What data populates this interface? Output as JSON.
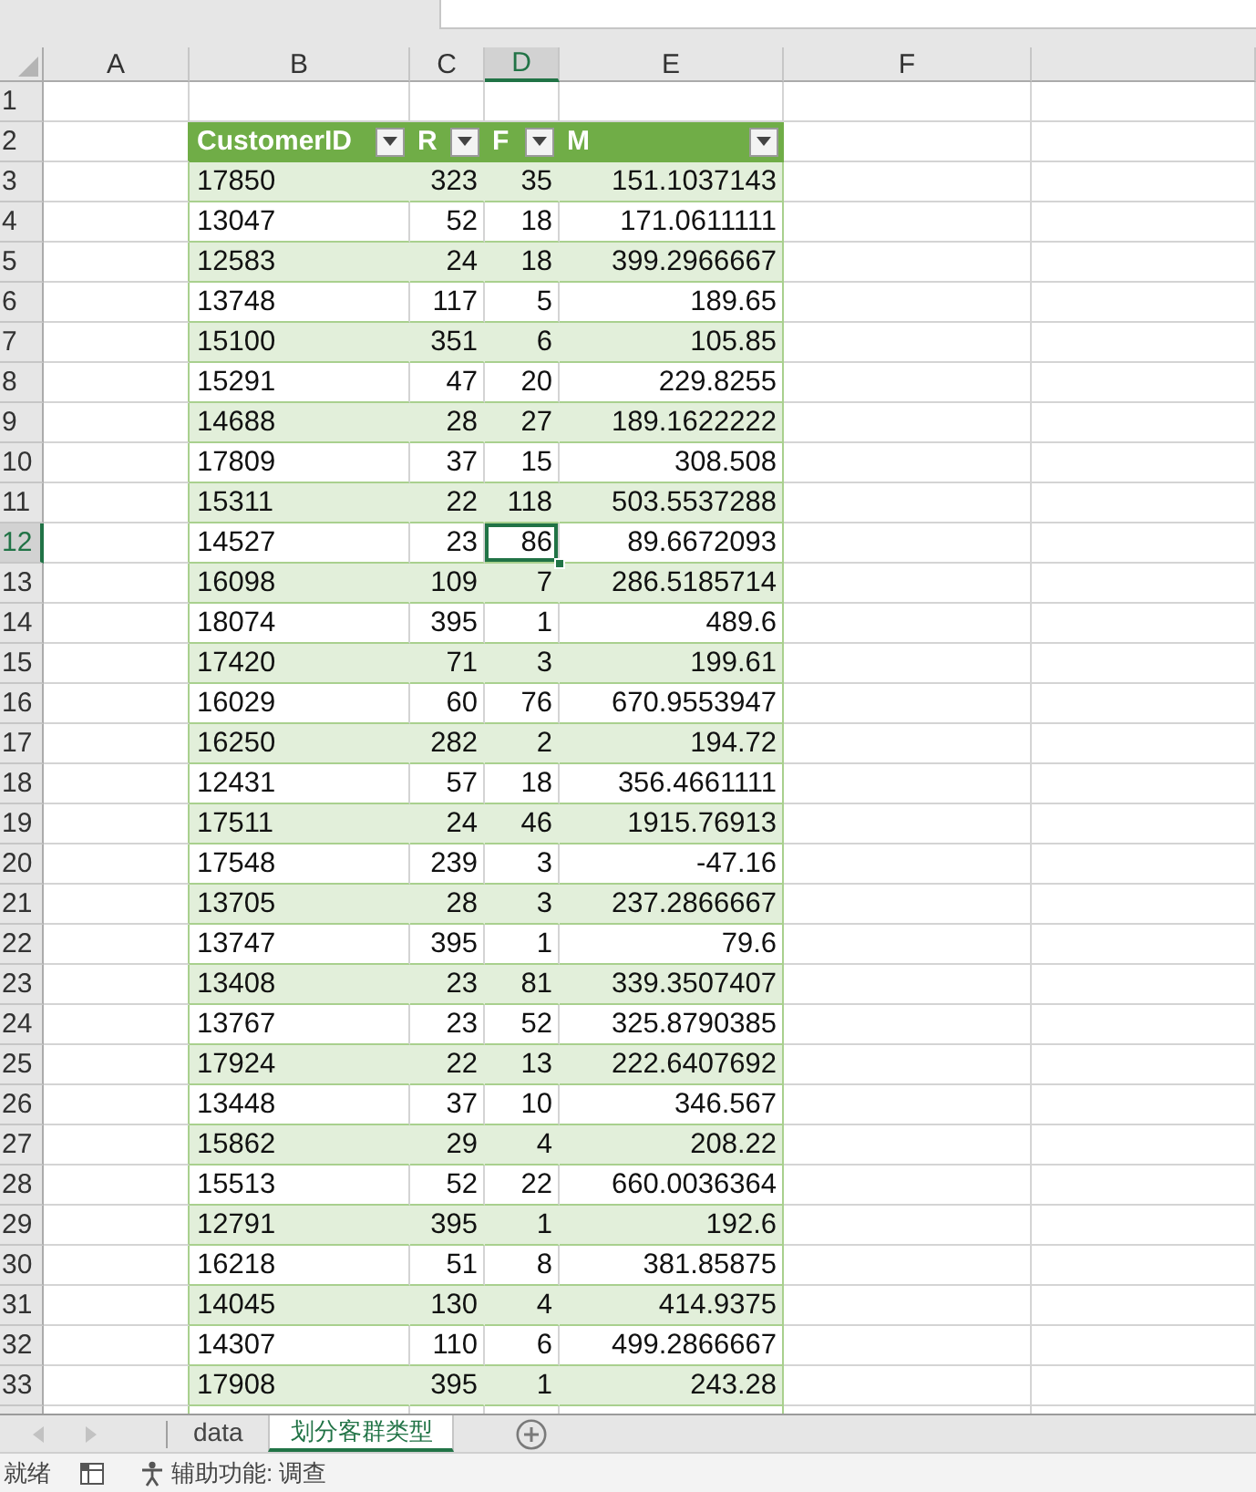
{
  "column_headers": [
    {
      "label": "A",
      "selected": false
    },
    {
      "label": "B",
      "selected": false
    },
    {
      "label": "C",
      "selected": false
    },
    {
      "label": "D",
      "selected": true
    },
    {
      "label": "E",
      "selected": false
    },
    {
      "label": "F",
      "selected": false
    }
  ],
  "row_headers": [
    {
      "label": "1",
      "selected": false
    },
    {
      "label": "2",
      "selected": false
    },
    {
      "label": "3",
      "selected": false
    },
    {
      "label": "4",
      "selected": false
    },
    {
      "label": "5",
      "selected": false
    },
    {
      "label": "6",
      "selected": false
    },
    {
      "label": "7",
      "selected": false
    },
    {
      "label": "8",
      "selected": false
    },
    {
      "label": "9",
      "selected": false
    },
    {
      "label": "10",
      "selected": false
    },
    {
      "label": "11",
      "selected": false
    },
    {
      "label": "12",
      "selected": true
    },
    {
      "label": "13",
      "selected": false
    },
    {
      "label": "14",
      "selected": false
    },
    {
      "label": "15",
      "selected": false
    },
    {
      "label": "16",
      "selected": false
    },
    {
      "label": "17",
      "selected": false
    },
    {
      "label": "18",
      "selected": false
    },
    {
      "label": "19",
      "selected": false
    },
    {
      "label": "20",
      "selected": false
    },
    {
      "label": "21",
      "selected": false
    },
    {
      "label": "22",
      "selected": false
    },
    {
      "label": "23",
      "selected": false
    },
    {
      "label": "24",
      "selected": false
    },
    {
      "label": "25",
      "selected": false
    },
    {
      "label": "26",
      "selected": false
    },
    {
      "label": "27",
      "selected": false
    },
    {
      "label": "28",
      "selected": false
    },
    {
      "label": "29",
      "selected": false
    },
    {
      "label": "30",
      "selected": false
    },
    {
      "label": "31",
      "selected": false
    },
    {
      "label": "32",
      "selected": false
    },
    {
      "label": "33",
      "selected": false
    }
  ],
  "table": {
    "columns": [
      {
        "label": "CustomerID",
        "kind": "text",
        "filter": true
      },
      {
        "label": "R",
        "kind": "number",
        "filter": true
      },
      {
        "label": "F",
        "kind": "number",
        "filter": true
      },
      {
        "label": "M",
        "kind": "number",
        "filter": true
      }
    ],
    "rows": [
      [
        {
          "text": "17850",
          "selected": false
        },
        {
          "text": "323",
          "selected": false
        },
        {
          "text": "35",
          "selected": false
        },
        {
          "text": "151.1037143",
          "selected": false
        }
      ],
      [
        {
          "text": "13047",
          "selected": false
        },
        {
          "text": "52",
          "selected": false
        },
        {
          "text": "18",
          "selected": false
        },
        {
          "text": "171.0611111",
          "selected": false
        }
      ],
      [
        {
          "text": "12583",
          "selected": false
        },
        {
          "text": "24",
          "selected": false
        },
        {
          "text": "18",
          "selected": false
        },
        {
          "text": "399.2966667",
          "selected": false
        }
      ],
      [
        {
          "text": "13748",
          "selected": false
        },
        {
          "text": "117",
          "selected": false
        },
        {
          "text": "5",
          "selected": false
        },
        {
          "text": "189.65",
          "selected": false
        }
      ],
      [
        {
          "text": "15100",
          "selected": false
        },
        {
          "text": "351",
          "selected": false
        },
        {
          "text": "6",
          "selected": false
        },
        {
          "text": "105.85",
          "selected": false
        }
      ],
      [
        {
          "text": "15291",
          "selected": false
        },
        {
          "text": "47",
          "selected": false
        },
        {
          "text": "20",
          "selected": false
        },
        {
          "text": "229.8255",
          "selected": false
        }
      ],
      [
        {
          "text": "14688",
          "selected": false
        },
        {
          "text": "28",
          "selected": false
        },
        {
          "text": "27",
          "selected": false
        },
        {
          "text": "189.1622222",
          "selected": false
        }
      ],
      [
        {
          "text": "17809",
          "selected": false
        },
        {
          "text": "37",
          "selected": false
        },
        {
          "text": "15",
          "selected": false
        },
        {
          "text": "308.508",
          "selected": false
        }
      ],
      [
        {
          "text": "15311",
          "selected": false
        },
        {
          "text": "22",
          "selected": false
        },
        {
          "text": "118",
          "selected": false
        },
        {
          "text": "503.5537288",
          "selected": false
        }
      ],
      [
        {
          "text": "14527",
          "selected": false
        },
        {
          "text": "23",
          "selected": false
        },
        {
          "text": "86",
          "selected": true
        },
        {
          "text": "89.6672093",
          "selected": false
        }
      ],
      [
        {
          "text": "16098",
          "selected": false
        },
        {
          "text": "109",
          "selected": false
        },
        {
          "text": "7",
          "selected": false
        },
        {
          "text": "286.5185714",
          "selected": false
        }
      ],
      [
        {
          "text": "18074",
          "selected": false
        },
        {
          "text": "395",
          "selected": false
        },
        {
          "text": "1",
          "selected": false
        },
        {
          "text": "489.6",
          "selected": false
        }
      ],
      [
        {
          "text": "17420",
          "selected": false
        },
        {
          "text": "71",
          "selected": false
        },
        {
          "text": "3",
          "selected": false
        },
        {
          "text": "199.61",
          "selected": false
        }
      ],
      [
        {
          "text": "16029",
          "selected": false
        },
        {
          "text": "60",
          "selected": false
        },
        {
          "text": "76",
          "selected": false
        },
        {
          "text": "670.9553947",
          "selected": false
        }
      ],
      [
        {
          "text": "16250",
          "selected": false
        },
        {
          "text": "282",
          "selected": false
        },
        {
          "text": "2",
          "selected": false
        },
        {
          "text": "194.72",
          "selected": false
        }
      ],
      [
        {
          "text": "12431",
          "selected": false
        },
        {
          "text": "57",
          "selected": false
        },
        {
          "text": "18",
          "selected": false
        },
        {
          "text": "356.4661111",
          "selected": false
        }
      ],
      [
        {
          "text": "17511",
          "selected": false
        },
        {
          "text": "24",
          "selected": false
        },
        {
          "text": "46",
          "selected": false
        },
        {
          "text": "1915.76913",
          "selected": false
        }
      ],
      [
        {
          "text": "17548",
          "selected": false
        },
        {
          "text": "239",
          "selected": false
        },
        {
          "text": "3",
          "selected": false
        },
        {
          "text": "-47.16",
          "selected": false
        }
      ],
      [
        {
          "text": "13705",
          "selected": false
        },
        {
          "text": "28",
          "selected": false
        },
        {
          "text": "3",
          "selected": false
        },
        {
          "text": "237.2866667",
          "selected": false
        }
      ],
      [
        {
          "text": "13747",
          "selected": false
        },
        {
          "text": "395",
          "selected": false
        },
        {
          "text": "1",
          "selected": false
        },
        {
          "text": "79.6",
          "selected": false
        }
      ],
      [
        {
          "text": "13408",
          "selected": false
        },
        {
          "text": "23",
          "selected": false
        },
        {
          "text": "81",
          "selected": false
        },
        {
          "text": "339.3507407",
          "selected": false
        }
      ],
      [
        {
          "text": "13767",
          "selected": false
        },
        {
          "text": "23",
          "selected": false
        },
        {
          "text": "52",
          "selected": false
        },
        {
          "text": "325.8790385",
          "selected": false
        }
      ],
      [
        {
          "text": "17924",
          "selected": false
        },
        {
          "text": "22",
          "selected": false
        },
        {
          "text": "13",
          "selected": false
        },
        {
          "text": "222.6407692",
          "selected": false
        }
      ],
      [
        {
          "text": "13448",
          "selected": false
        },
        {
          "text": "37",
          "selected": false
        },
        {
          "text": "10",
          "selected": false
        },
        {
          "text": "346.567",
          "selected": false
        }
      ],
      [
        {
          "text": "15862",
          "selected": false
        },
        {
          "text": "29",
          "selected": false
        },
        {
          "text": "4",
          "selected": false
        },
        {
          "text": "208.22",
          "selected": false
        }
      ],
      [
        {
          "text": "15513",
          "selected": false
        },
        {
          "text": "52",
          "selected": false
        },
        {
          "text": "22",
          "selected": false
        },
        {
          "text": "660.0036364",
          "selected": false
        }
      ],
      [
        {
          "text": "12791",
          "selected": false
        },
        {
          "text": "395",
          "selected": false
        },
        {
          "text": "1",
          "selected": false
        },
        {
          "text": "192.6",
          "selected": false
        }
      ],
      [
        {
          "text": "16218",
          "selected": false
        },
        {
          "text": "51",
          "selected": false
        },
        {
          "text": "8",
          "selected": false
        },
        {
          "text": "381.85875",
          "selected": false
        }
      ],
      [
        {
          "text": "14045",
          "selected": false
        },
        {
          "text": "130",
          "selected": false
        },
        {
          "text": "4",
          "selected": false
        },
        {
          "text": "414.9375",
          "selected": false
        }
      ],
      [
        {
          "text": "14307",
          "selected": false
        },
        {
          "text": "110",
          "selected": false
        },
        {
          "text": "6",
          "selected": false
        },
        {
          "text": "499.2866667",
          "selected": false
        }
      ],
      [
        {
          "text": "17908",
          "selected": false
        },
        {
          "text": "395",
          "selected": false
        },
        {
          "text": "1",
          "selected": false
        },
        {
          "text": "243.28",
          "selected": false
        }
      ]
    ]
  },
  "sheet_tabs": [
    {
      "label": "data",
      "selected": false
    },
    {
      "label": "划分客群类型",
      "selected": true
    }
  ],
  "status_bar": {
    "status": "就绪",
    "accessibility": "辅助功能: 调查"
  }
}
